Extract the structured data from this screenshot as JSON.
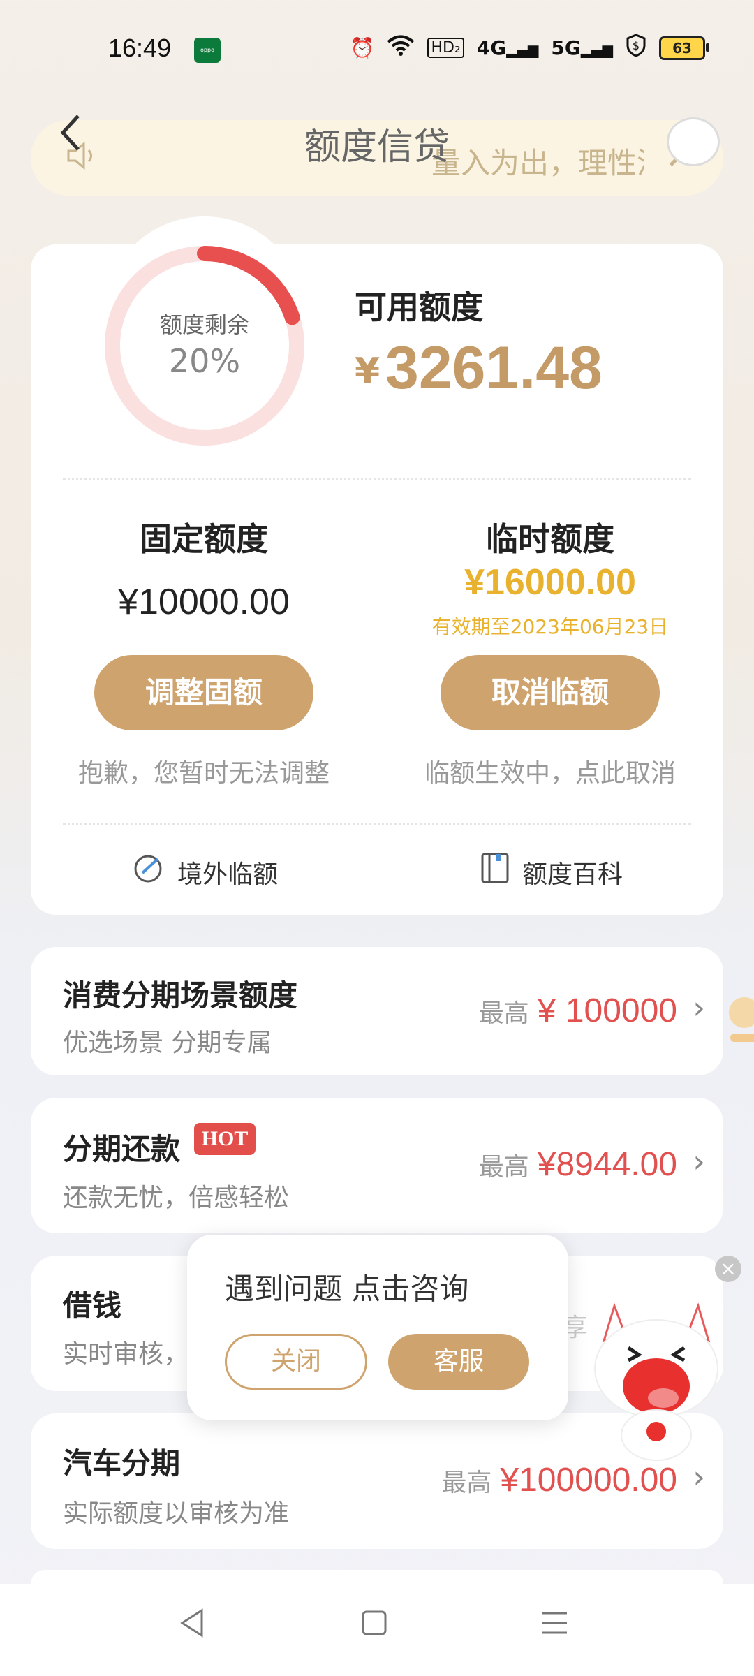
{
  "status_bar": {
    "time": "16:49",
    "carrier_badge": "oppo",
    "net1": "4G",
    "net2": "5G",
    "hd": "HD₂",
    "battery": "63"
  },
  "header": {
    "title": "额度信贷",
    "notice": "量入为出，理性消费"
  },
  "credit": {
    "ring_label": "额度剩余",
    "ring_percent": "20%",
    "remaining_fraction": 0.2,
    "available_label": "可用额度",
    "currency": "¥",
    "available_amount": "3261.48"
  },
  "fixed": {
    "title": "固定额度",
    "amount": "¥10000.00",
    "button": "调整固额",
    "note": "抱歉，您暂时无法调整"
  },
  "temp": {
    "title": "临时额度",
    "amount": "¥16000.00",
    "valid": "有效期至2023年06月23日",
    "button": "取消临额",
    "note": "临额生效中，点此取消"
  },
  "links": {
    "overseas": "境外临额",
    "wiki": "额度百科"
  },
  "list": [
    {
      "title": "消费分期场景额度",
      "sub": "优选场景 分期专属",
      "prefix": "最高",
      "amount": "¥ 100000"
    },
    {
      "title": "分期还款",
      "badge": "HOT",
      "sub": "还款无忧，倍感轻松",
      "prefix": "最高",
      "amount": "¥8944.00"
    },
    {
      "title": "借钱",
      "sub": "实时审核，",
      "partial": "享"
    },
    {
      "title": "汽车分期",
      "sub": "实际额度以审核为准",
      "prefix": "最高",
      "amount": "¥100000.00"
    }
  ],
  "popup": {
    "title": "遇到问题 点击咨询",
    "close": "关闭",
    "service": "客服"
  },
  "colors": {
    "accent": "#cfa36d",
    "amount_gold": "#c49a66",
    "temp_yellow": "#e9b22e",
    "red": "#e0514f",
    "ring_track": "#fbe0e0",
    "ring_fill": "#e85050"
  }
}
